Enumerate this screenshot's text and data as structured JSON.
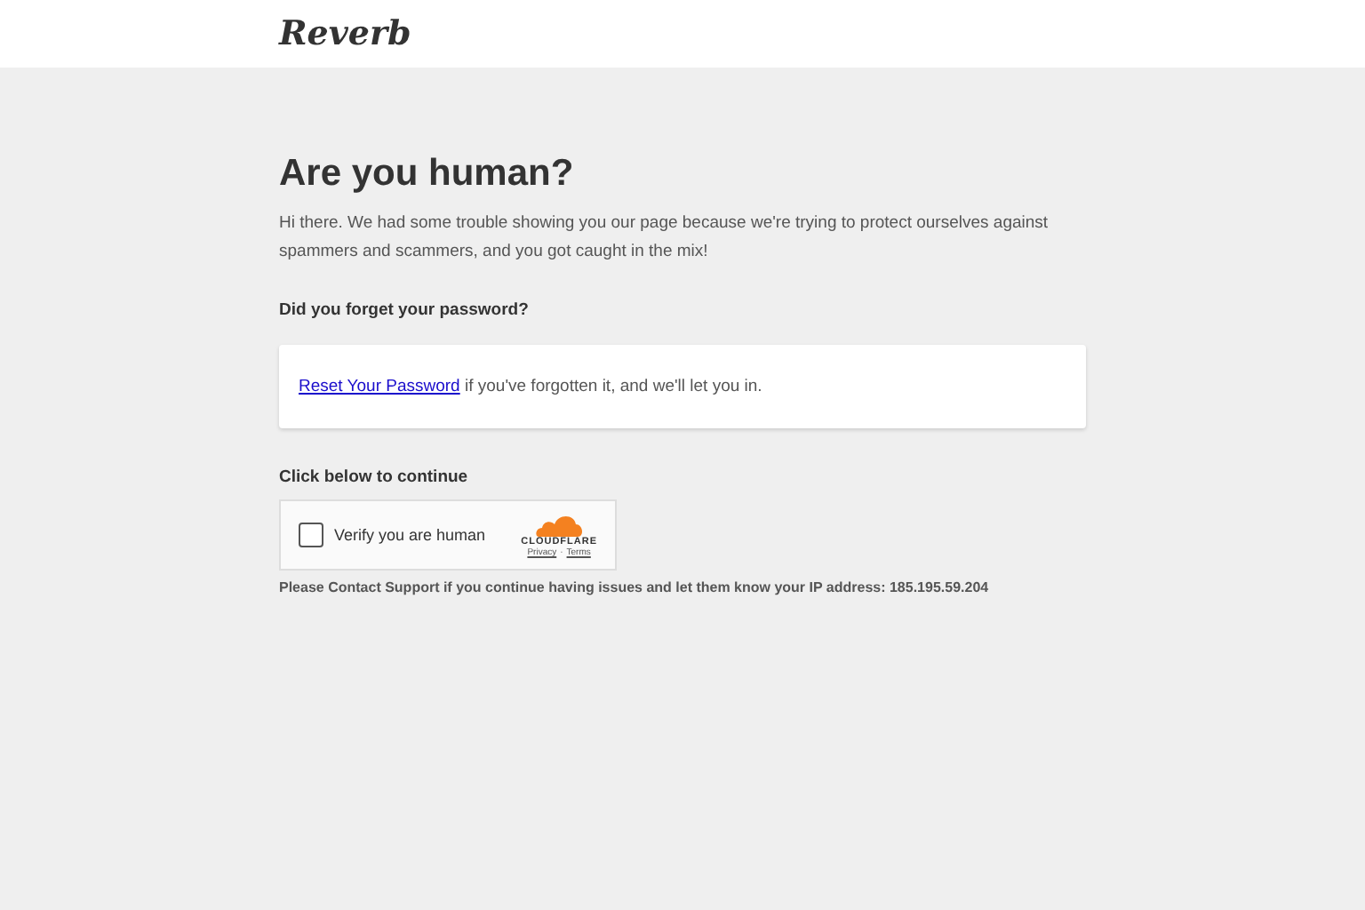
{
  "header": {
    "logo": "Reverb"
  },
  "title": "Are you human?",
  "intro": "Hi there. We had some trouble showing you our page because we're trying to protect ourselves against spammers and scammers, and you got caught in the mix!",
  "password_heading": "Did you forget your password?",
  "password_card": {
    "link": "Reset Your Password",
    "text": "if you've forgotten it, and we'll let you in."
  },
  "continue_heading": "Click below to continue",
  "captcha": {
    "label": "Verify you are human",
    "checked": false,
    "brand": "CLOUDFLARE",
    "privacy": "Privacy",
    "separator": "·",
    "terms": "Terms"
  },
  "footer_note": "Please Contact Support if you continue having issues and let them know your IP address: 185.195.59.204"
}
